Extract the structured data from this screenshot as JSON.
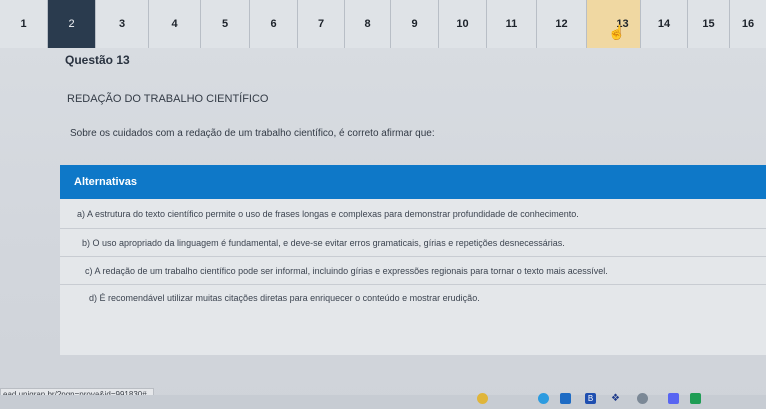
{
  "question_nav": {
    "numbers": [
      "1",
      "2",
      "3",
      "4",
      "5",
      "6",
      "7",
      "8",
      "9",
      "10",
      "11",
      "12",
      "13",
      "14",
      "15",
      "16"
    ],
    "current": "13"
  },
  "question": {
    "title": "Questão 13",
    "subject": "REDAÇÃO DO TRABALHO CIENTÍFICO",
    "prompt": "Sobre os cuidados com a redação de um trabalho científico, é correto afirmar que:"
  },
  "alternatives": {
    "header": "Alternativas",
    "items": [
      "a) A estrutura do texto científico permite o uso de frases longas e complexas para demonstrar profundidade de conhecimento.",
      "b) O uso apropriado da linguagem é fundamental, e deve-se evitar erros gramaticais, gírias e repetições desnecessárias.",
      "c) A redação de um trabalho científico pode ser informal, incluindo gírias e expressões regionais para tornar o texto mais acessível.",
      "d) É recomendável utilizar muitas citações diretas para enriquecer o conteúdo e mostrar erudição."
    ]
  },
  "status_bar": {
    "url": "ead.unigran.br/?pgn=prova&id=991830#"
  },
  "taskbar": {
    "icons": [
      "chrome-icon",
      "circle-app-icon",
      "store-icon",
      "b-app-icon",
      "dropbox-icon",
      "cloud-icon",
      "discord-icon",
      "sheets-icon"
    ]
  },
  "colors": {
    "accent_blue": "#0e78c8",
    "nav_dark": "#2a3b4e",
    "nav_current": "#f0d8a2"
  }
}
